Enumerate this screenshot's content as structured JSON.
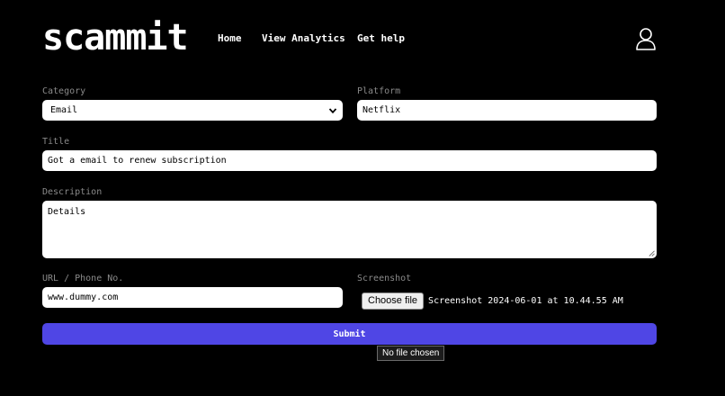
{
  "header": {
    "logo": "scammit",
    "nav": [
      "Home",
      "View Analytics",
      "Get help"
    ],
    "user_icon": "user-icon"
  },
  "form": {
    "category": {
      "label": "Category",
      "value": "Email"
    },
    "platform": {
      "label": "Platform",
      "value": "Netflix"
    },
    "title": {
      "label": "Title",
      "value": "Got a email to renew subscription"
    },
    "description": {
      "label": "Description",
      "value": "Details"
    },
    "url": {
      "label": "URL / Phone No.",
      "value": "www.dummy.com"
    },
    "screenshot": {
      "label": "Screenshot",
      "button": "Choose file",
      "file_name": "Screenshot 2024-06-01 at 10.44.55 AM"
    },
    "submit": "Submit"
  },
  "tooltip": "No file chosen",
  "colors": {
    "background": "#000000",
    "accent": "#4f46e5",
    "label": "#8a8a8a",
    "field": "#ffffff"
  }
}
